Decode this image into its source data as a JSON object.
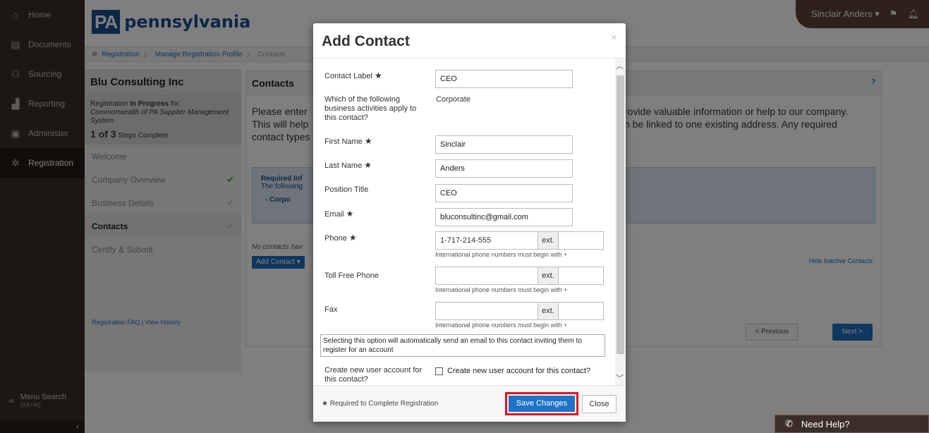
{
  "nav": {
    "items": [
      {
        "label": "Home",
        "icon": "home-icon"
      },
      {
        "label": "Documents",
        "icon": "documents-icon"
      },
      {
        "label": "Sourcing",
        "icon": "sourcing-icon"
      },
      {
        "label": "Reporting",
        "icon": "reporting-icon"
      },
      {
        "label": "Administer",
        "icon": "administer-icon"
      },
      {
        "label": "Registration",
        "icon": "gear-icon"
      }
    ],
    "search_label": "Menu Search",
    "search_shortcut": "(Alt+M)"
  },
  "header": {
    "logo_pa": "PA",
    "logo_name": "pennsylvania",
    "user_name": "Sinclair Anders ▾"
  },
  "breadcrumb": {
    "item1": "Registration",
    "item2": "Manage Registration Profile",
    "item3": "Contacts"
  },
  "sidebar": {
    "company": "Blu Consulting Inc",
    "progress_prefix": "Registration",
    "progress_status": "In Progress",
    "progress_for": "for:",
    "progress_system": "Commonwealth of PA Supplier Management System",
    "steps_count": "1 of 3",
    "steps_label": "Steps Complete",
    "steps": [
      {
        "label": "Welcome"
      },
      {
        "label": "Company Overview"
      },
      {
        "label": "Business Details"
      },
      {
        "label": "Contacts"
      },
      {
        "label": "Certify & Submit"
      }
    ],
    "faq": "Registration FAQ",
    "history": "View History"
  },
  "panel": {
    "title": "Contacts",
    "help": "?",
    "intro_l1": "Please enter",
    "intro_l2": "This will help",
    "intro_l3": "contact types",
    "intro_r1": "rovide valuable information or help to our company.",
    "intro_r2": "n be linked to one existing address. Any required",
    "info_title": "Required Inf",
    "info_line": "The following",
    "info_item": "-  Corpo",
    "no_contacts": "No contacts hav",
    "add_contact": "Add Contact ▾",
    "hide_inactive": "Hide Inactive Contacts",
    "prev": "< Previous",
    "next": "Next >"
  },
  "need_help": "Need Help?",
  "modal": {
    "title": "Add Contact",
    "close_x": "×",
    "fields": {
      "contact_label": {
        "label": "Contact Label",
        "value": "CEO"
      },
      "activities": {
        "label": "Which of the following business activities apply to this contact?",
        "value": "Corporate"
      },
      "first_name": {
        "label": "First Name",
        "value": "Sinclair"
      },
      "last_name": {
        "label": "Last Name",
        "value": "Anders"
      },
      "position": {
        "label": "Position Title",
        "value": "CEO"
      },
      "email": {
        "label": "Email",
        "value": "bluconsultinc@gmail.com"
      },
      "phone": {
        "label": "Phone",
        "value": "1-717-214-555",
        "ext_label": "ext.",
        "ext_value": ""
      },
      "toll_free": {
        "label": "Toll Free Phone",
        "value": "",
        "ext_label": "ext.",
        "ext_value": ""
      },
      "fax": {
        "label": "Fax",
        "value": "",
        "ext_label": "ext.",
        "ext_value": ""
      }
    },
    "intl_hint": "International phone numbers must begin with +",
    "notice": "Selecting this option will automatically send an email to this contact inviting them to register for an account",
    "create_account_label": "Create new user account for this contact?",
    "create_account_checkbox": "Create new user account for this contact?",
    "required_note": "Required to Complete Registration",
    "save": "Save Changes",
    "close": "Close"
  },
  "colors": {
    "nav_bg": "#3b2e27",
    "brand_blue": "#1b4d8f",
    "button_blue": "#1f73c7",
    "highlight_red": "#e1131f",
    "check_green": "#4a9a2f"
  }
}
